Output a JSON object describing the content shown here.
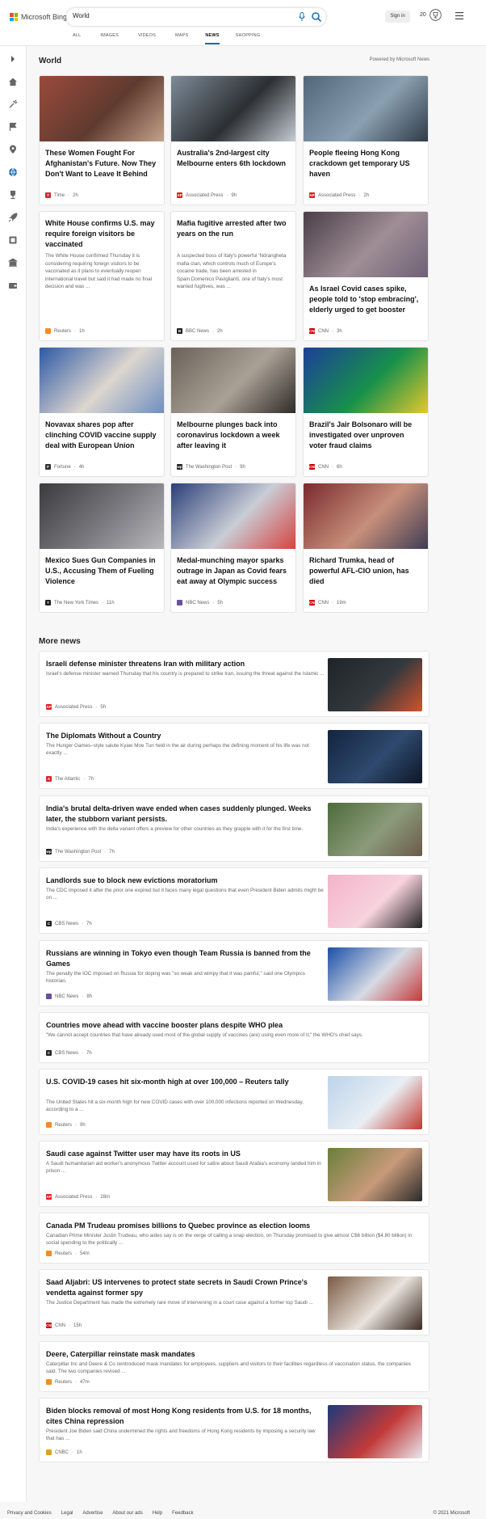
{
  "header": {
    "brand": "Microsoft Bing",
    "search_value": "World",
    "signin_label": "Sign in",
    "points": "20",
    "tabs": [
      {
        "label": "ALL",
        "active": false
      },
      {
        "label": "IMAGES",
        "active": false
      },
      {
        "label": "VIDEOS",
        "active": false
      },
      {
        "label": "MAPS",
        "active": false
      },
      {
        "label": "NEWS",
        "active": true
      },
      {
        "label": "SHOPPING",
        "active": false
      }
    ]
  },
  "sidebar": {
    "icons": [
      "chevron-right-icon",
      "home-icon",
      "tools-icon",
      "flag-icon",
      "location-icon",
      "globe-icon",
      "trophy-icon",
      "rocket-icon",
      "film-icon",
      "bank-icon",
      "wallet-icon"
    ]
  },
  "world": {
    "title": "World",
    "powered": "Powered by Microsoft News",
    "cards": [
      {
        "title": "These Women Fought For Afghanistan's Future. Now They Don't Want to Leave It Behind",
        "snippet": "",
        "source": "Time",
        "time": "2h",
        "logo": "T",
        "logo_color": "#d6262e",
        "img": [
          "#9a4b3a",
          "#5f3a30",
          "#c3a38a"
        ]
      },
      {
        "title": "Australia's 2nd-largest city Melbourne enters 6th lockdown",
        "snippet": "",
        "source": "Associated Press",
        "time": "9h",
        "logo": "AP",
        "logo_color": "#e02020",
        "img": [
          "#7d8b98",
          "#2c2f33",
          "#c5ccd3"
        ]
      },
      {
        "title": "People fleeing Hong Kong crackdown get temporary US haven",
        "snippet": "",
        "source": "Associated Press",
        "time": "2h",
        "logo": "AP",
        "logo_color": "#e02020",
        "img": [
          "#52667a",
          "#8aa0b2",
          "#2f3b47"
        ]
      },
      {
        "title": "White House confirms U.S. may require foreign visitors be vaccinated",
        "snippet": "The White House confirmed Thursday it is considering requiring foreign visitors to be vaccinated as it plans to eventually reopen international travel but said it had made no final decision and was ...",
        "source": "Reuters",
        "time": "1h",
        "logo": "",
        "logo_color": "#f28c28",
        "img": null
      },
      {
        "title": "Mafia fugitive arrested after two years on the run",
        "snippet": "A suspected boss of Italy's powerful 'Ndrangheta mafia clan, which controls much of Europe's cocaine trade, has been arrested in Spain.Domenico Pavigliantí, one of Italy's most wanted fugitives, was ...",
        "source": "BBC News",
        "time": "2h",
        "logo": "B",
        "logo_color": "#222222",
        "img": null
      },
      {
        "title": "As Israel Covid cases spike, people told to 'stop embracing', elderly urged to get booster",
        "snippet": "",
        "source": "CNN",
        "time": "3h",
        "logo": "CNN",
        "logo_color": "#cc0000",
        "img": [
          "#4a3e49",
          "#9f8e95",
          "#6e6175"
        ]
      },
      {
        "title": "Novavax shares pop after clinching COVID vaccine supply deal with European Union",
        "snippet": "",
        "source": "Fortune",
        "time": "4h",
        "logo": "F",
        "logo_color": "#333333",
        "img": [
          "#2e58a6",
          "#dcd6cf",
          "#6f8fc0"
        ]
      },
      {
        "title": "Melbourne plunges back into coronavirus lockdown a week after leaving it",
        "snippet": "",
        "source": "The Washington Post",
        "time": "9h",
        "logo": "wp",
        "logo_color": "#222222",
        "img": [
          "#6a6259",
          "#aaa196",
          "#2f2b28"
        ]
      },
      {
        "title": "Brazil's Jair Bolsonaro will be investigated over unproven voter fraud claims",
        "snippet": "",
        "source": "CNN",
        "time": "6h",
        "logo": "CNN",
        "logo_color": "#cc0000",
        "img": [
          "#1c3f9a",
          "#17914a",
          "#e5c82d"
        ]
      },
      {
        "title": "Mexico Sues Gun Companies in U.S., Accusing Them of Fueling Violence",
        "snippet": "",
        "source": "The New York Times",
        "time": "11h",
        "logo": "T",
        "logo_color": "#222222",
        "img": [
          "#3b3a3d",
          "#7b7a80",
          "#b9b8bd"
        ]
      },
      {
        "title": "Medal-munching mayor sparks outrage in Japan as Covid fears eat away at Olympic success",
        "snippet": "",
        "source": "NBC News",
        "time": "5h",
        "logo": "",
        "logo_color": "#6b4fa0",
        "img": [
          "#2a3f78",
          "#c9cdd6",
          "#d54340"
        ]
      },
      {
        "title": "Richard Trumka, head of powerful AFL-CIO union, has died",
        "snippet": "",
        "source": "CNN",
        "time": "19m",
        "logo": "CNN",
        "logo_color": "#cc0000",
        "img": [
          "#7b2a2f",
          "#c78f7a",
          "#3f3c55"
        ]
      }
    ]
  },
  "more_news": {
    "title": "More news",
    "items": [
      {
        "title": "Israeli defense minister threatens Iran with military action",
        "snippet": "Israel's defense minister warned Thursday that his country is prepared to strike Iran, issuing the threat against the Islamic ...",
        "source": "Associated Press",
        "time": "5h",
        "logo": "AP",
        "logo_color": "#e02020",
        "img": [
          "#1f2428",
          "#34393e",
          "#d4532b"
        ]
      },
      {
        "title": "The Diplomats Without a Country",
        "snippet": "The Hunger Games–style salute Kyaw Moe Tun held in the air during perhaps the defining moment of his life was not exactly ...",
        "source": "The Atlantic",
        "time": "7h",
        "logo": "A",
        "logo_color": "#d6262e",
        "img": [
          "#13243f",
          "#2f4a6e",
          "#0d1627"
        ]
      },
      {
        "title": "India's brutal delta-driven wave ended when cases suddenly plunged. Weeks later, the stubborn variant persists.",
        "snippet": "India's experience with the delta variant offers a preview for other countries as they grapple with it for the first time.",
        "source": "The Washington Post",
        "time": "7h",
        "logo": "wp",
        "logo_color": "#222222",
        "img": [
          "#4d6b3a",
          "#8b9b7a",
          "#6b5a4a"
        ]
      },
      {
        "title": "Landlords sue to block new evictions moratorium",
        "snippet": "The CDC imposed it after the prior one expired but it faces many legal questions that even President Biden admits might be on ...",
        "source": "CBS News",
        "time": "7h",
        "logo": "C",
        "logo_color": "#222222",
        "img": [
          "#f4b3c9",
          "#f7d3de",
          "#222222"
        ]
      },
      {
        "title": "Russians are winning in Tokyo even though Team Russia is banned from the Games",
        "snippet": "The penalty the IOC imposed on Russia for doping was \"so weak and wimpy that it was painful,\" said one Olympics historian.",
        "source": "NBC News",
        "time": "8h",
        "logo": "",
        "logo_color": "#6b4fa0",
        "img": [
          "#1b4fa8",
          "#d7dbe4",
          "#c23a3a"
        ]
      },
      {
        "title": "Countries move ahead with vaccine booster plans despite WHO plea",
        "snippet": "\"We cannot accept countries that have already used most of the global supply of vaccines (are) using even more of it,\" the WHO's chief says.",
        "source": "CBS News",
        "time": "7h",
        "logo": "C",
        "logo_color": "#222222",
        "img": null
      },
      {
        "title": "U.S. COVID-19 cases hit six-month high at over 100,000 – Reuters tally",
        "snippet": "The United States hit a six-month high for new COVID cases with over 100,000 infections reported on Wednesday, according to a ...",
        "source": "Reuters",
        "time": "9h",
        "logo": "",
        "logo_color": "#f28c28",
        "img": [
          "#bcd4ea",
          "#e8eef4",
          "#c23a30"
        ]
      },
      {
        "title": "Saudi case against Twitter user may have its roots in US",
        "snippet": "A Saudi humanitarian aid worker's anonymous Twitter account used for satire about Saudi Arabia's economy landed him in prison ...",
        "source": "Associated Press",
        "time": "28m",
        "logo": "AP",
        "logo_color": "#e02020",
        "img": [
          "#6a7f3a",
          "#c89a7a",
          "#2a2a2a"
        ]
      },
      {
        "title": "Canada PM Trudeau promises billions to Quebec province as election looms",
        "snippet": "Canadian Prime Minister Justin Trudeau, who aides say is on the verge of calling a snap election, on Thursday promised to give almost C$6 billion ($4.80 billion) in social spending to the politically ...",
        "source": "Reuters",
        "time": "54m",
        "logo": "",
        "logo_color": "#f28c28",
        "img": null
      },
      {
        "title": "Saad Aljabri: US intervenes to protect state secrets in Saudi Crown Prince's vendetta against former spy",
        "snippet": "The Justice Department has made the extremely rare move of intervening in a court case against a former top Saudi ...",
        "source": "CNN",
        "time": "15h",
        "logo": "CNN",
        "logo_color": "#cc0000",
        "img": [
          "#7a5a44",
          "#e9e3dc",
          "#3a2a22"
        ]
      },
      {
        "title": "Deere, Caterpillar reinstate mask mandates",
        "snippet": "Caterpillar Inc and Deere & Co reintroduced mask mandates for employees, suppliers and visitors to their facilities regardless of vaccination status, the companies said. The two companies revised ...",
        "source": "Reuters",
        "time": "47m",
        "logo": "",
        "logo_color": "#f28c28",
        "img": null
      },
      {
        "title": "Biden blocks removal of most Hong Kong residents from U.S. for 18 months, cites China repression",
        "snippet": "President Joe Biden said China undermined the rights and freedoms of Hong Kong residents by imposing a security law that has ...",
        "source": "CNBC",
        "time": "1h",
        "logo": "",
        "logo_color": "#e0a020",
        "img": [
          "#1b3a7a",
          "#c23a3a",
          "#e8e8ee"
        ]
      }
    ]
  },
  "footer": {
    "links": [
      "Privacy and Cookies",
      "Legal",
      "Advertise",
      "About our ads",
      "Help",
      "Feedback"
    ],
    "copyright": "© 2021 Microsoft"
  }
}
